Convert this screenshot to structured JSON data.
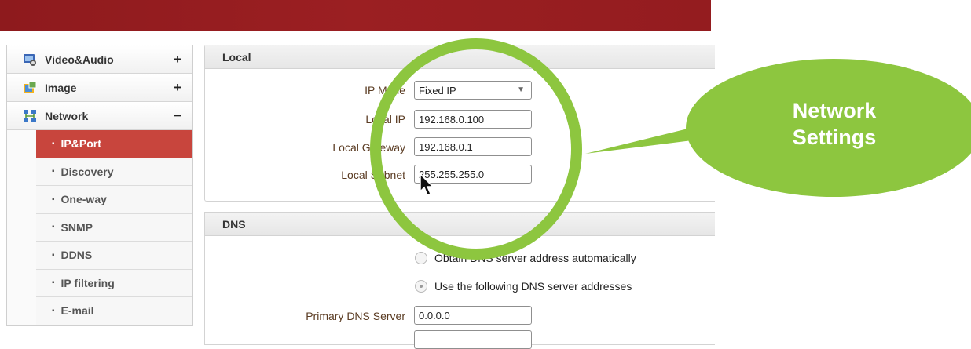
{
  "colors": {
    "topbar": "#941c1f",
    "active_item": "#c8453d",
    "callout_green": "#8dc63f",
    "label_brown": "#5a3b22"
  },
  "sidebar": {
    "menus": [
      {
        "label": "Video&Audio",
        "icon": "video-audio-icon",
        "sign": "+"
      },
      {
        "label": "Image",
        "icon": "image-icon",
        "sign": "+"
      },
      {
        "label": "Network",
        "icon": "network-icon",
        "sign": "−"
      }
    ],
    "network_items": [
      {
        "label": "IP&Port"
      },
      {
        "label": "Discovery"
      },
      {
        "label": "One-way"
      },
      {
        "label": "SNMP"
      },
      {
        "label": "DDNS"
      },
      {
        "label": "IP filtering"
      },
      {
        "label": "E-mail"
      }
    ]
  },
  "local": {
    "title": "Local",
    "ip_mode_label": "IP Mode",
    "ip_mode_value": "Fixed IP",
    "local_ip_label": "Local IP",
    "local_ip_value": "192.168.0.100",
    "gateway_label": "Local Gateway",
    "gateway_value": "192.168.0.1",
    "subnet_label": "Local Subnet",
    "subnet_value": "255.255.255.0"
  },
  "dns": {
    "title": "DNS",
    "auto_label": "Obtain DNS server address automatically",
    "manual_label": "Use the following DNS server addresses",
    "primary_label": "Primary DNS Server",
    "primary_value": "0.0.0.0"
  },
  "callout": {
    "line1": "Network",
    "line2": "Settings"
  }
}
